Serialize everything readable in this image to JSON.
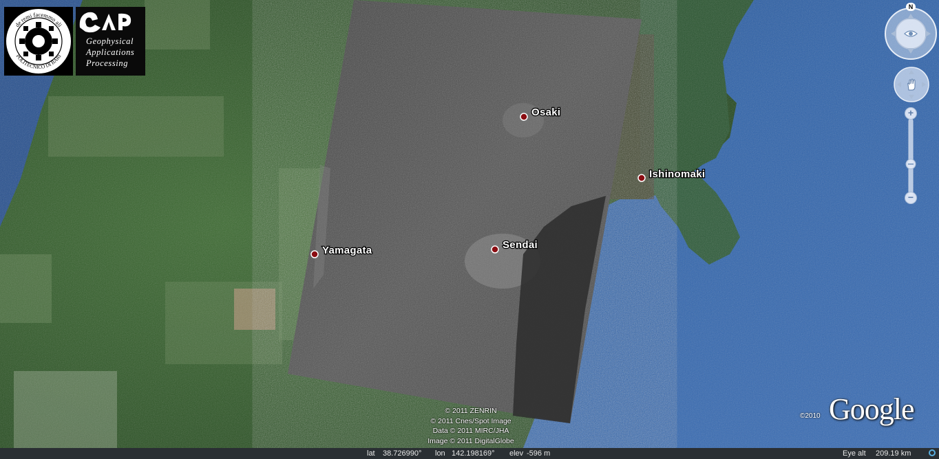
{
  "logos": {
    "politecnico_motto": "de remi facemmo ali",
    "politecnico_name": "POLITECNICO DI BARI",
    "gap_mark": "GAP",
    "gap_lines": [
      "Geophysical",
      "Applications",
      "Processing"
    ]
  },
  "places": [
    {
      "name": "Osaki"
    },
    {
      "name": "Ishinomaki"
    },
    {
      "name": "Yamagata"
    },
    {
      "name": "Sendai"
    }
  ],
  "navigation": {
    "north_label": "N",
    "look_icon": "eye-icon",
    "move_icon": "hand-icon",
    "zoom_in_icon": "plus-icon",
    "zoom_out_icon": "minus-icon",
    "zoom_level": 0.6
  },
  "attribution": [
    "© 2011 ZENRIN",
    "© 2011 Cnes/Spot Image",
    "Data © 2011 MIRC/JHA",
    "Image © 2011 DigitalGlobe"
  ],
  "google": {
    "copyright": "©2010",
    "wordmark": "Google"
  },
  "status": {
    "lat_label": "lat",
    "lat_value": "38.726990°",
    "lon_label": "lon",
    "lon_value": "142.198169°",
    "elev_label": "elev",
    "elev_value": "-596 m",
    "eye_alt_label": "Eye alt",
    "eye_alt_value": "209.19 km",
    "streaming_icon": "streaming-circle-icon"
  },
  "colors": {
    "ocean": "#2d5ea6",
    "land": "#2f5a2a",
    "sar_overlay": "#4a4a4a",
    "pin": "#8b0d12"
  }
}
